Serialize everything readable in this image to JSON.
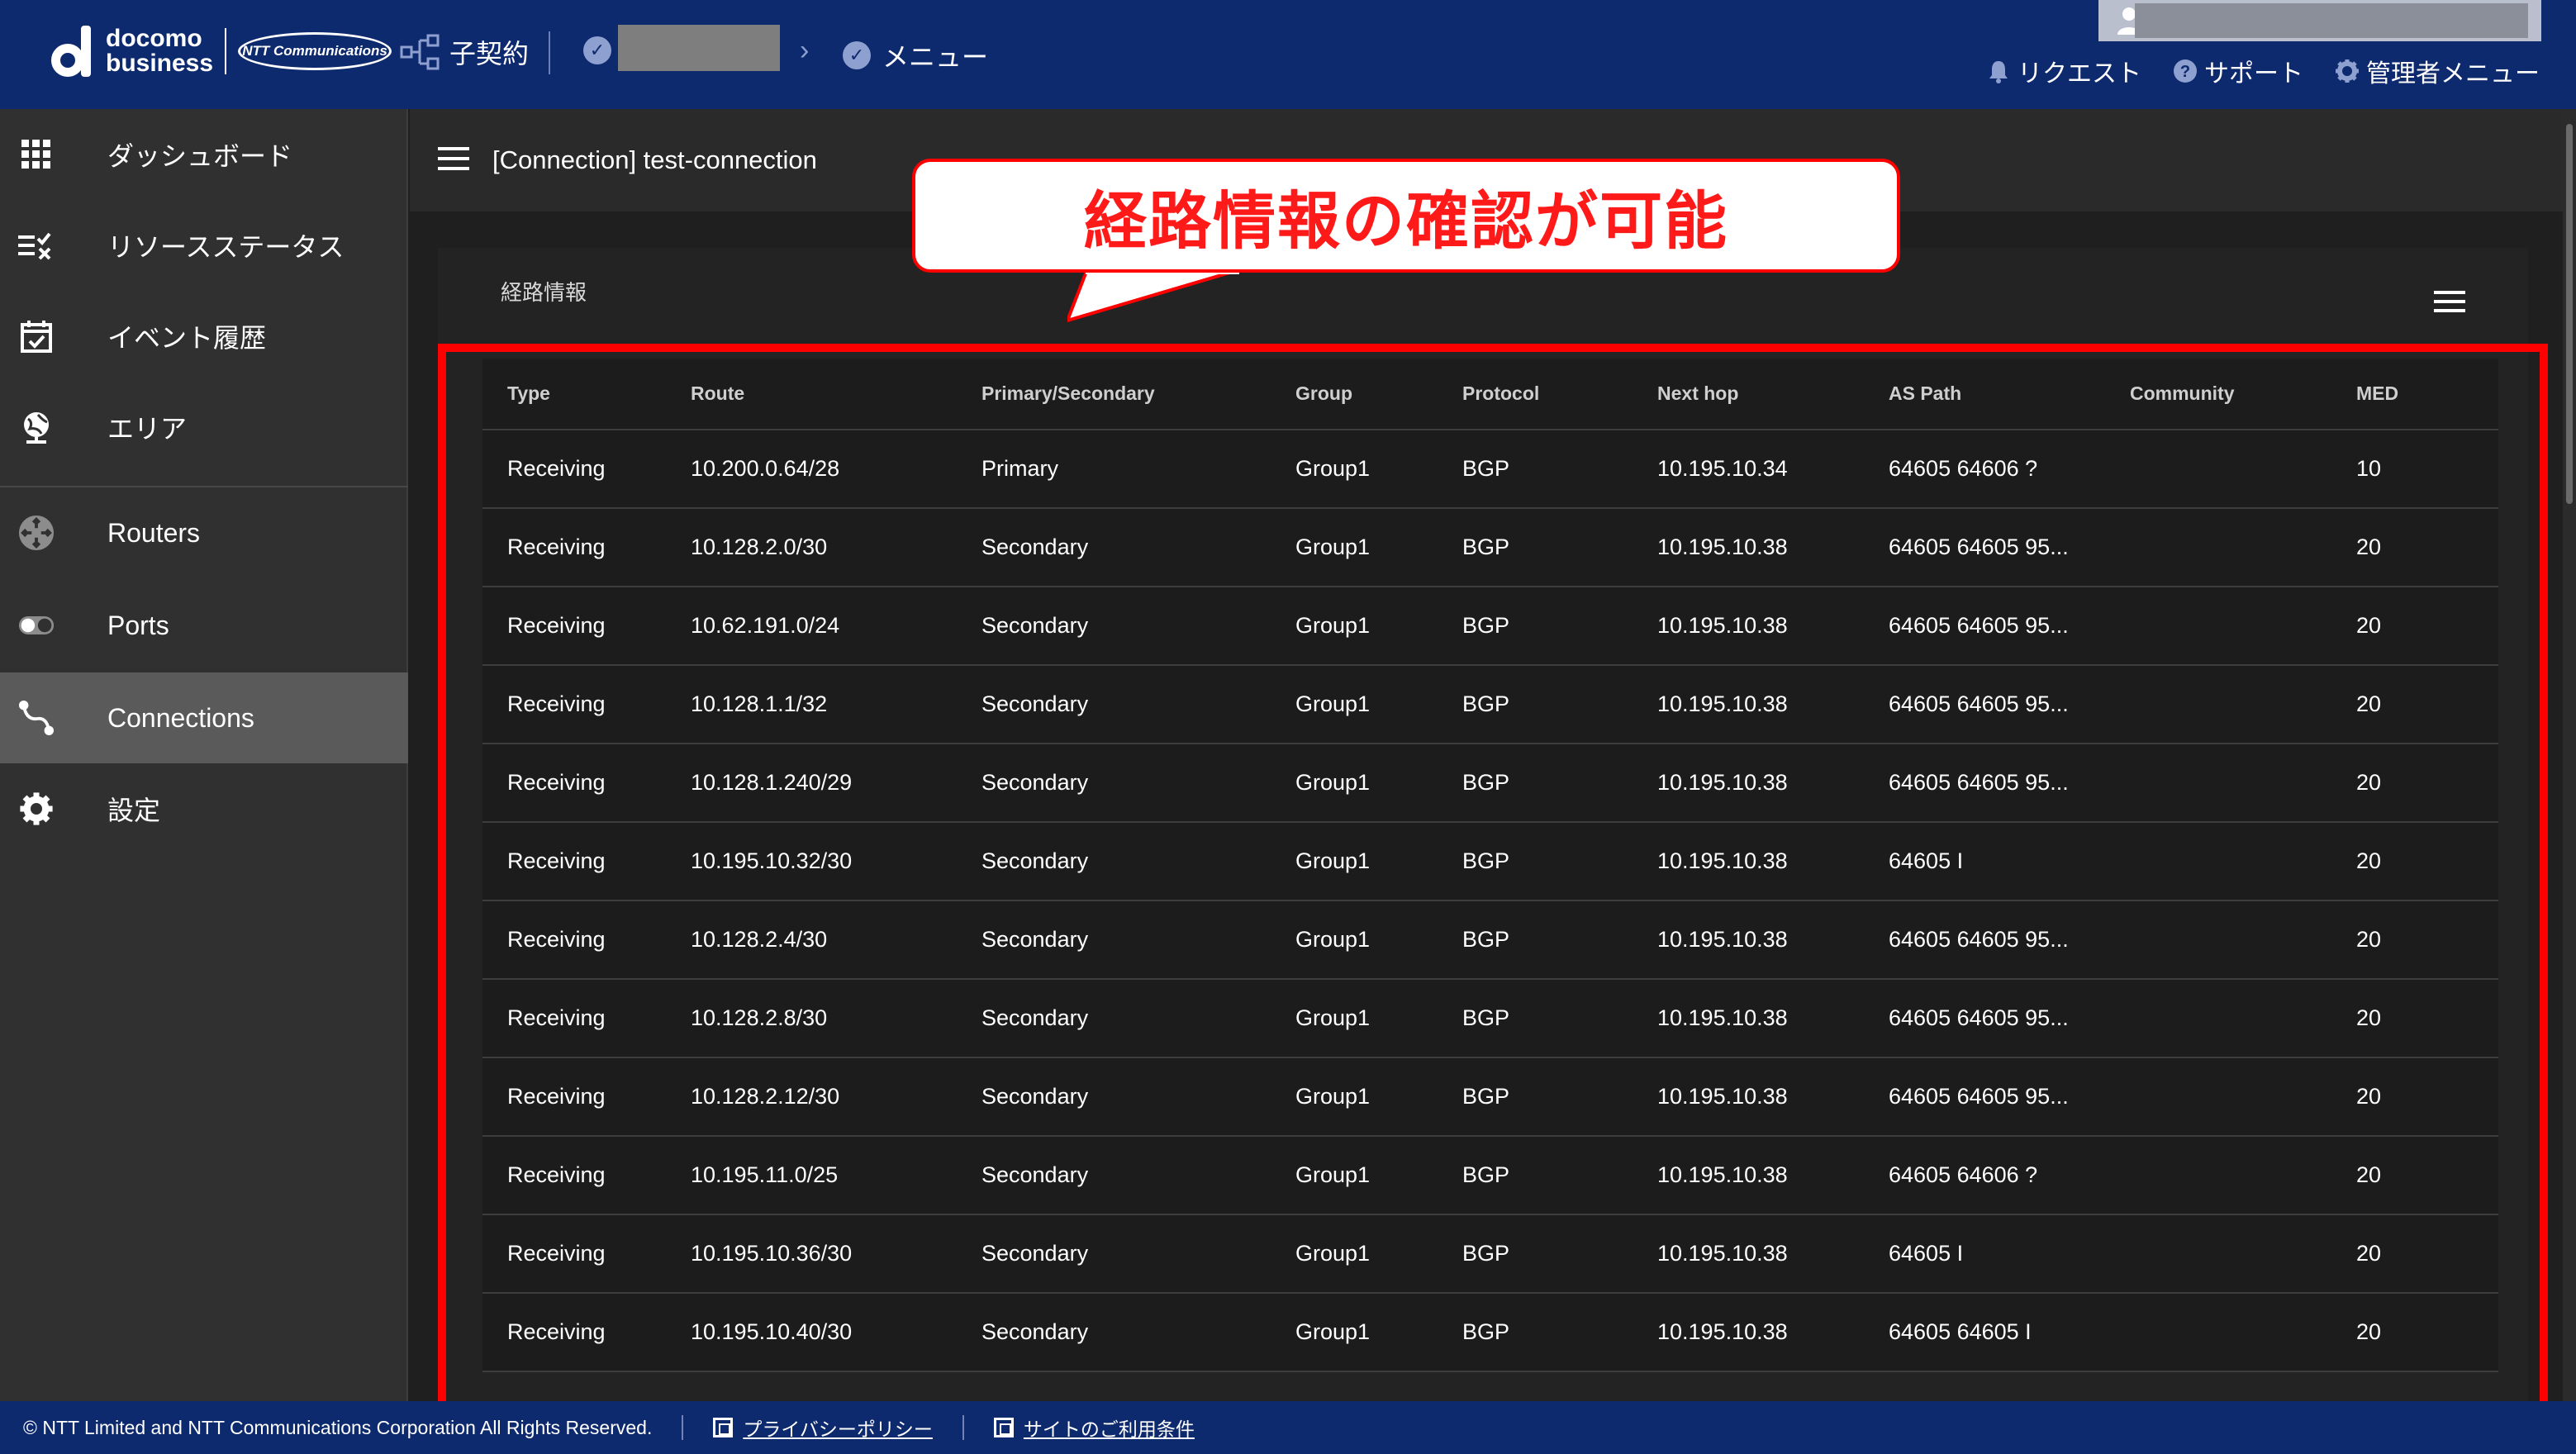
{
  "header": {
    "brand_line1": "docomo",
    "brand_line2": "business",
    "partner_logo": "NTT Communications",
    "contract_label": "子契約",
    "menu_label": "メニュー",
    "links": [
      {
        "icon": "bell-icon",
        "label": "リクエスト"
      },
      {
        "icon": "help-icon",
        "label": "サポート"
      },
      {
        "icon": "gear-icon",
        "label": "管理者メニュー"
      }
    ]
  },
  "sidebar": {
    "items": [
      {
        "icon": "grid-icon",
        "label": "ダッシュボード"
      },
      {
        "icon": "list-check-icon",
        "label": "リソースステータス"
      },
      {
        "icon": "calendar-check-icon",
        "label": "イベント履歴"
      },
      {
        "icon": "globe-icon",
        "label": "エリア"
      },
      {
        "icon": "router-icon",
        "label": "Routers"
      },
      {
        "icon": "port-icon",
        "label": "Ports"
      },
      {
        "icon": "connection-icon",
        "label": "Connections",
        "active": true
      },
      {
        "icon": "gear-icon",
        "label": "設定"
      }
    ]
  },
  "main": {
    "page_title": "[Connection] test-connection",
    "card_title": "経路情報",
    "callout": "経路情報の確認が可能"
  },
  "table": {
    "columns": [
      "Type",
      "Route",
      "Primary/Secondary",
      "Group",
      "Protocol",
      "Next hop",
      "AS Path",
      "Community",
      "MED"
    ],
    "rows": [
      [
        "Receiving",
        "10.200.0.64/28",
        "Primary",
        "Group1",
        "BGP",
        "10.195.10.34",
        "64605 64606 ?",
        "",
        "10"
      ],
      [
        "Receiving",
        "10.128.2.0/30",
        "Secondary",
        "Group1",
        "BGP",
        "10.195.10.38",
        "64605 64605 95...",
        "",
        "20"
      ],
      [
        "Receiving",
        "10.62.191.0/24",
        "Secondary",
        "Group1",
        "BGP",
        "10.195.10.38",
        "64605 64605 95...",
        "",
        "20"
      ],
      [
        "Receiving",
        "10.128.1.1/32",
        "Secondary",
        "Group1",
        "BGP",
        "10.195.10.38",
        "64605 64605 95...",
        "",
        "20"
      ],
      [
        "Receiving",
        "10.128.1.240/29",
        "Secondary",
        "Group1",
        "BGP",
        "10.195.10.38",
        "64605 64605 95...",
        "",
        "20"
      ],
      [
        "Receiving",
        "10.195.10.32/30",
        "Secondary",
        "Group1",
        "BGP",
        "10.195.10.38",
        "64605 I",
        "",
        "20"
      ],
      [
        "Receiving",
        "10.128.2.4/30",
        "Secondary",
        "Group1",
        "BGP",
        "10.195.10.38",
        "64605 64605 95...",
        "",
        "20"
      ],
      [
        "Receiving",
        "10.128.2.8/30",
        "Secondary",
        "Group1",
        "BGP",
        "10.195.10.38",
        "64605 64605 95...",
        "",
        "20"
      ],
      [
        "Receiving",
        "10.128.2.12/30",
        "Secondary",
        "Group1",
        "BGP",
        "10.195.10.38",
        "64605 64605 95...",
        "",
        "20"
      ],
      [
        "Receiving",
        "10.195.11.0/25",
        "Secondary",
        "Group1",
        "BGP",
        "10.195.10.38",
        "64605 64606 ?",
        "",
        "20"
      ],
      [
        "Receiving",
        "10.195.10.36/30",
        "Secondary",
        "Group1",
        "BGP",
        "10.195.10.38",
        "64605 I",
        "",
        "20"
      ],
      [
        "Receiving",
        "10.195.10.40/30",
        "Secondary",
        "Group1",
        "BGP",
        "10.195.10.38",
        "64605 64605 I",
        "",
        "20"
      ]
    ]
  },
  "footer": {
    "copyright": "© NTT Limited and NTT Communications Corporation All Rights Reserved.",
    "privacy": "プライバシーポリシー",
    "terms": "サイトのご利用条件"
  },
  "colors": {
    "header_bg": "#0e2a6e",
    "sidebar_bg": "#303030",
    "active_item_bg": "#5a5a5a",
    "highlight": "#ff0000"
  }
}
